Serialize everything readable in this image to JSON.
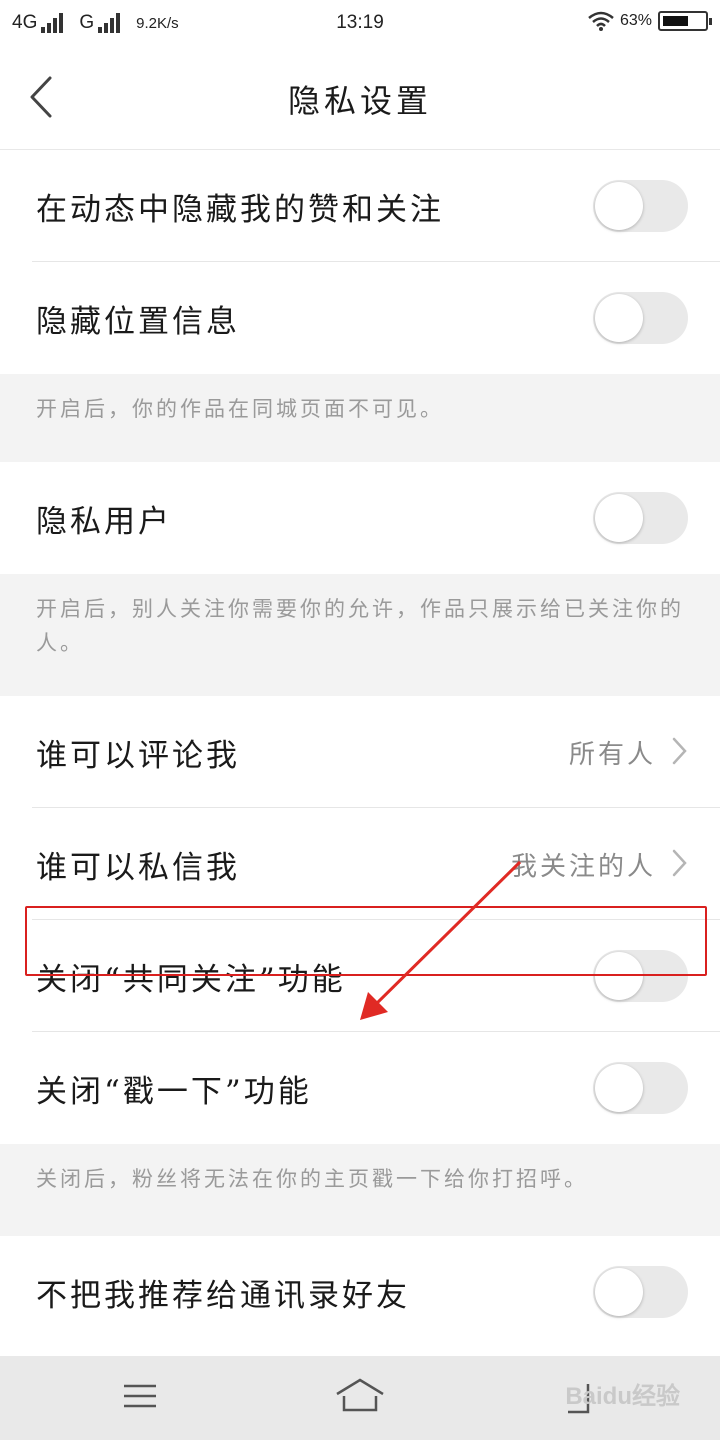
{
  "status_bar": {
    "network_1": "4G",
    "network_2": "G",
    "speed": "9.2K/s",
    "time": "13:19",
    "battery_percent": "63%",
    "battery_level": 0.63
  },
  "header": {
    "title": "隐私设置",
    "back_icon": "chevron-left-icon"
  },
  "settings": {
    "hide_likes_follows": {
      "label": "在动态中隐藏我的赞和关注",
      "on": false
    },
    "hide_location": {
      "label": "隐藏位置信息",
      "on": false
    },
    "hide_location_note": "开启后，你的作品在同城页面不可见。",
    "private_user": {
      "label": "隐私用户",
      "on": false
    },
    "private_user_note": "开启后，别人关注你需要你的允许，作品只展示给已关注你的人。",
    "who_can_comment": {
      "label": "谁可以评论我",
      "value": "所有人"
    },
    "who_can_message": {
      "label": "谁可以私信我",
      "value": "我关注的人"
    },
    "close_mutual_follow": {
      "label": "关闭“共同关注”功能",
      "on": false
    },
    "close_poke": {
      "label": "关闭“戳一下”功能",
      "on": false
    },
    "close_poke_note": "关闭后，粉丝将无法在你的主页戳一下给你打招呼。",
    "no_recommend_contacts": {
      "label": "不把我推荐给通讯录好友",
      "on": false
    }
  },
  "annotation": {
    "highlight_color": "#d9201f",
    "arrow_color": "#e02a24"
  },
  "bottom_bar": {
    "menu_icon": "menu-icon",
    "home_icon": "home-icon",
    "back_icon": "back-icon"
  },
  "watermark": "Baidu经验"
}
